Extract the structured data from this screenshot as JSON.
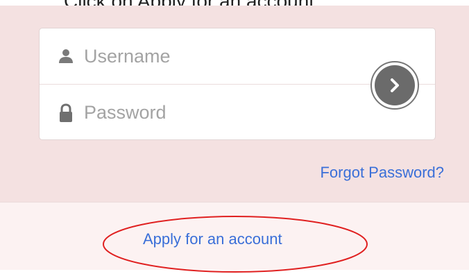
{
  "header": {
    "cropped_title": "Click on Apply for an account"
  },
  "login": {
    "username_placeholder": "Username",
    "password_placeholder": "Password",
    "forgot_password_label": "Forgot Password?"
  },
  "apply": {
    "apply_label": "Apply for an account"
  },
  "colors": {
    "panel_background": "#f4e1e1",
    "apply_background": "#fcf2f2",
    "link": "#3a6fd8",
    "annotation": "#e02020",
    "submit_button": "#6b6b6b"
  },
  "icons": {
    "username": "user-icon",
    "password": "lock-icon",
    "submit": "chevron-right-icon"
  }
}
